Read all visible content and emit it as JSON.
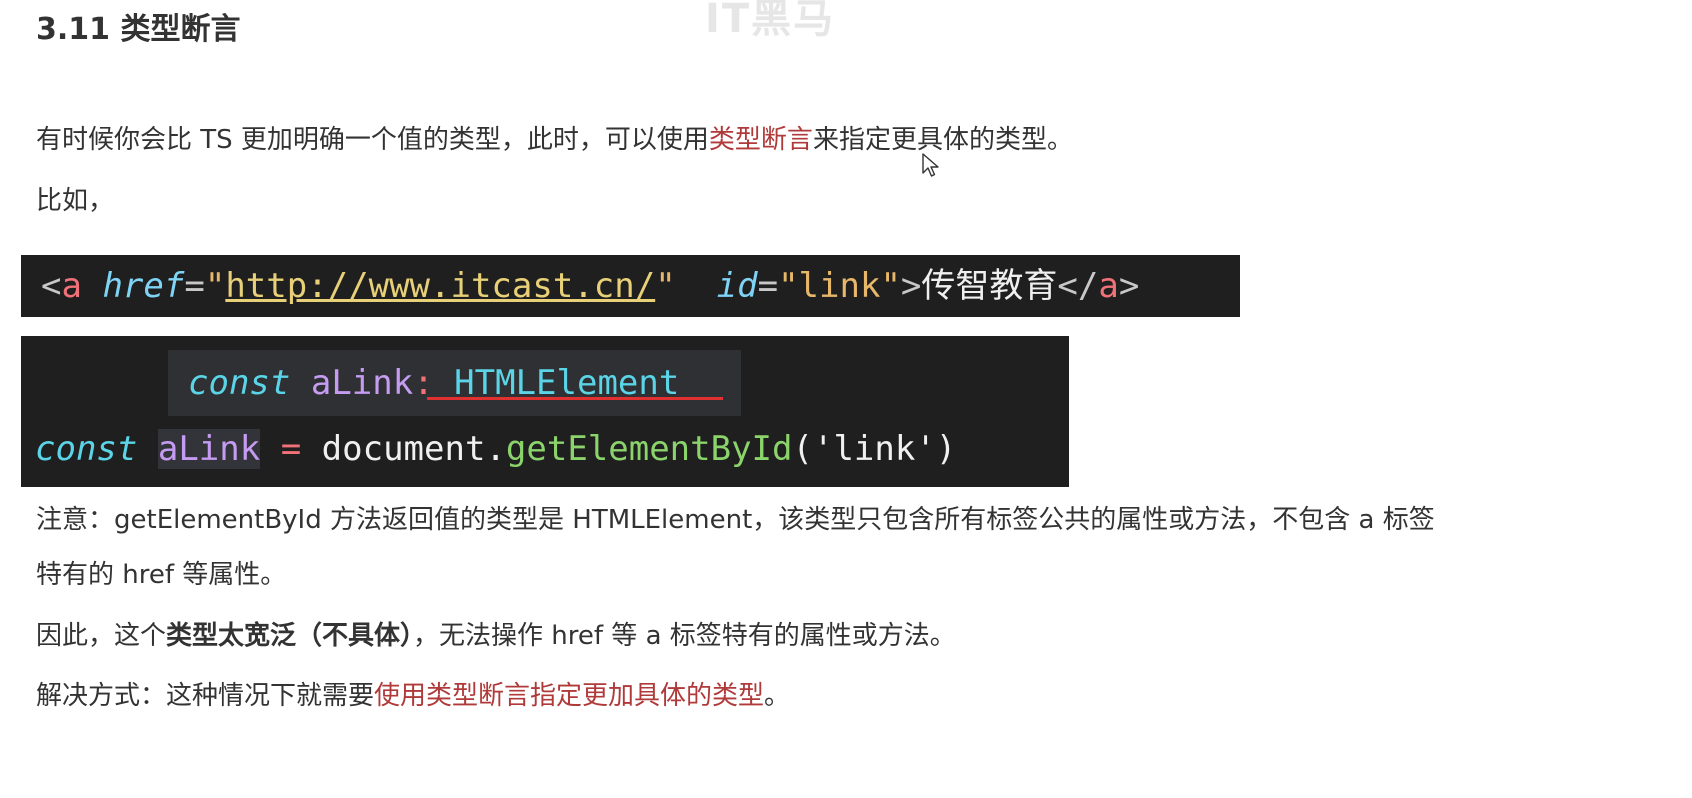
{
  "watermark": "IT黑马",
  "heading": "3.11 类型断言",
  "intro": {
    "before": "有时候你会比 TS 更加明确一个值的类型，此时，可以使用",
    "highlight": "类型断言",
    "after": "来指定更具体的类型。"
  },
  "example_label": "比如，",
  "code_html": {
    "lt": "<",
    "tag": "a",
    "attr1": "href",
    "eq": "=",
    "q": "\"",
    "url": "http://www.itcast.cn/",
    "attr2": "id",
    "id_value": "link",
    "gt": ">",
    "text": "传智教育",
    "close_open": "</",
    "close_tag": "a",
    "close_gt": ">"
  },
  "code_ts": {
    "hint_keyword": "const",
    "hint_var": "aLink",
    "hint_colon": ":",
    "hint_type": "HTMLElement",
    "keyword": "const",
    "var": "aLink",
    "eq": "=",
    "obj": "document",
    "dot": ".",
    "method": "getElementById",
    "paren_open": "(",
    "arg": "'link'",
    "paren_close": ")"
  },
  "note": {
    "line1": "注意：getElementById 方法返回值的类型是 HTMLElement，该类型只包含所有标签公共的属性或方法，不包含 a 标签",
    "line2": "特有的 href 等属性。"
  },
  "therefore": {
    "before": "因此，这个",
    "bold": "类型太宽泛（不具体）",
    "after": "，无法操作 href 等 a 标签特有的属性或方法。"
  },
  "solution": {
    "before": "解决方式：这种情况下就需要",
    "highlight": "使用类型断言指定更加具体的类型",
    "after": "。"
  },
  "colors": {
    "highlight": "#b03a3a",
    "code_bg": "#1f1f1f",
    "hint_bg": "#2f3033",
    "underline": "#e03030"
  }
}
